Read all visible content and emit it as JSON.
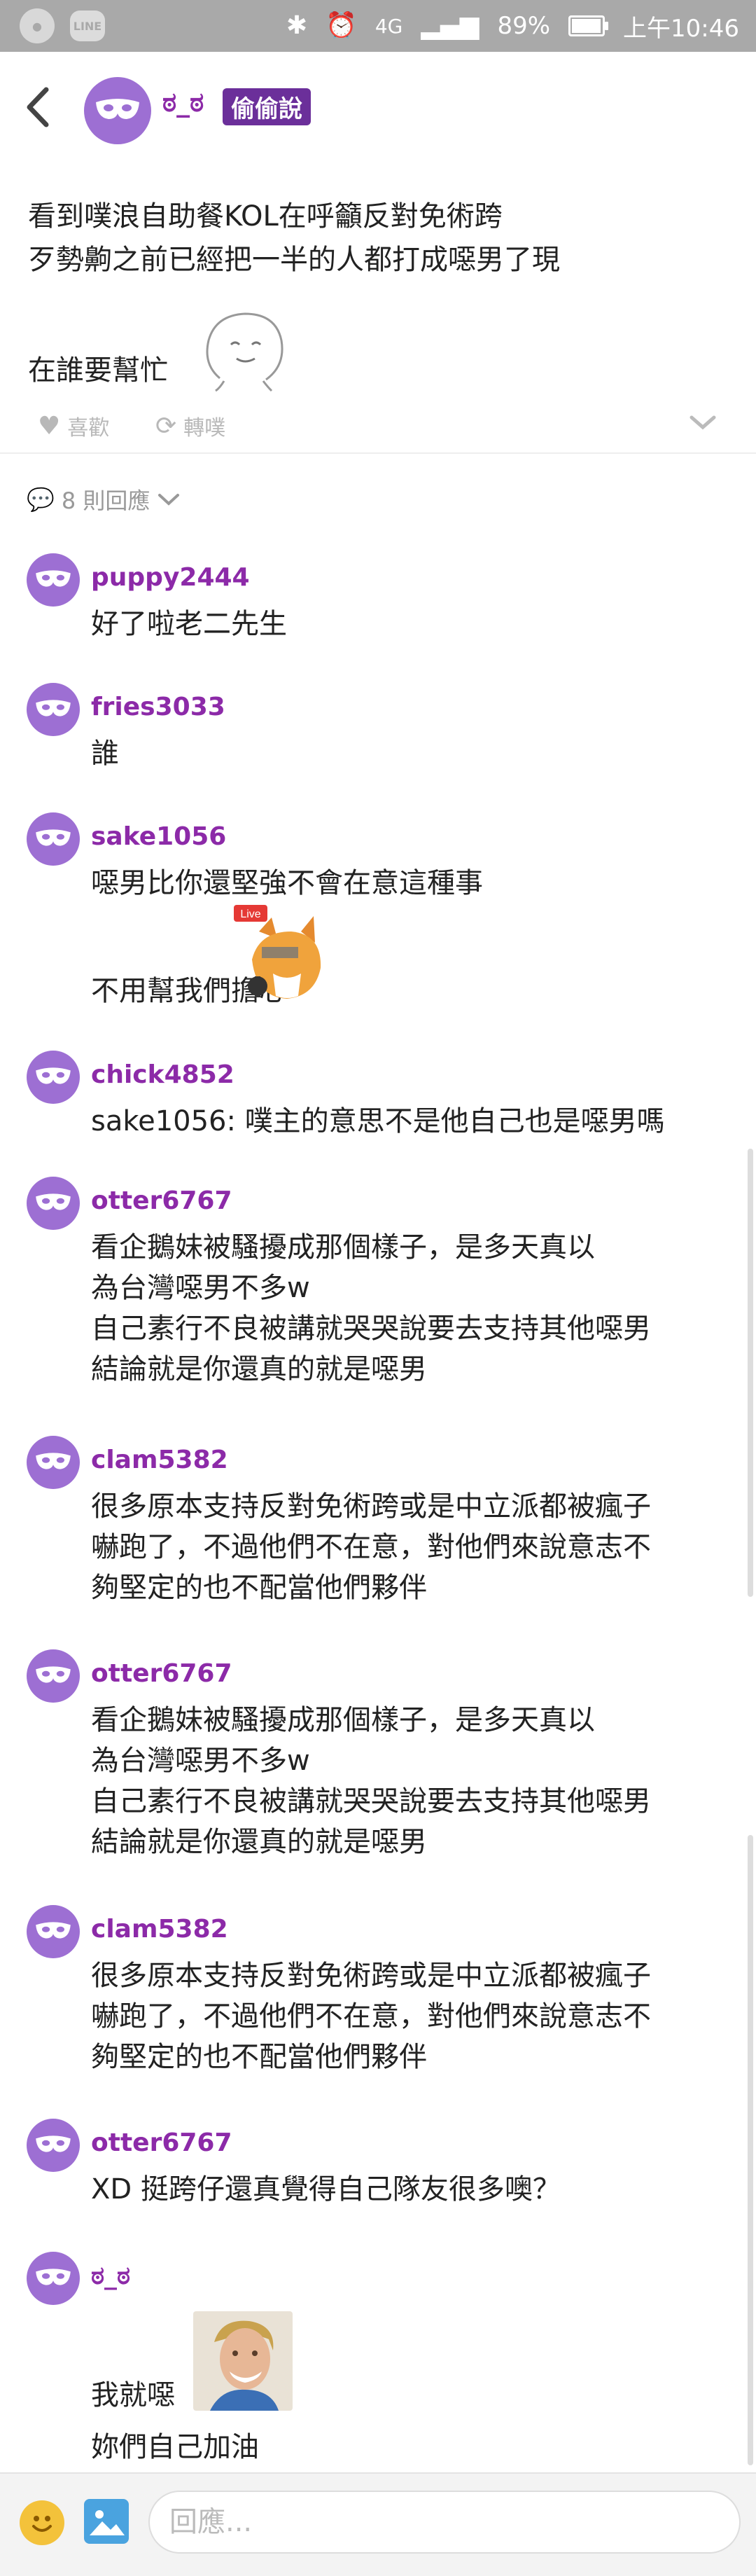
{
  "status_bar": {
    "icons_left": [
      "chat-bubble-icon",
      "line-app-icon"
    ],
    "line_label": "LINE",
    "network": "4G",
    "battery": "89%",
    "battery_level": 0.89,
    "time": "上午10:46"
  },
  "top_bar": {
    "op_name": "ಠ_ಠ",
    "badge": "偷偷說"
  },
  "post": {
    "lines": [
      "看到噗浪自助餐KOL在呼籲反對免術跨",
      "歹勢齁之前已經把一半的人都打成噁男了現"
    ],
    "tail": "在誰要幫忙"
  },
  "actions": {
    "like": "喜歡",
    "share": "轉噗"
  },
  "replies_header": "8 則回應",
  "replies": [
    {
      "name": "puppy2444",
      "lines": [
        "好了啦老二先生"
      ]
    },
    {
      "name": "fries3033",
      "lines": [
        "誰"
      ]
    },
    {
      "name": "sake1056",
      "lines": [
        "噁男比你還堅強不會在意這種事"
      ],
      "extra": "不用幫我們擔心"
    },
    {
      "name": "chick4852",
      "lines": [
        "sake1056: 噗主的意思不是他自己也是噁男嗎"
      ]
    },
    {
      "name": "otter6767",
      "lines": [
        "看企鵝妹被騷擾成那個樣子，是多天真以",
        "為台灣噁男不多w",
        "自己素行不良被講就哭哭說要去支持其他噁男",
        "結論就是你還真的就是噁男"
      ]
    },
    {
      "name": "clam5382",
      "lines": [
        "很多原本支持反對免術跨或是中立派都被瘋子",
        "嚇跑了，不過他們不在意，對他們來說意志不",
        "夠堅定的也不配當他們夥伴"
      ]
    },
    {
      "name": "otter6767",
      "lines": [
        "看企鵝妹被騷擾成那個樣子，是多天真以",
        "為台灣噁男不多w",
        "自己素行不良被講就哭哭說要去支持其他噁男",
        "結論就是你還真的就是噁男"
      ]
    },
    {
      "name": "clam5382",
      "lines": [
        "很多原本支持反對免術跨或是中立派都被瘋子",
        "嚇跑了，不過他們不在意，對他們來說意志不",
        "夠堅定的也不配當他們夥伴"
      ]
    },
    {
      "name": "otter6767",
      "lines": [
        "XD 挺跨仔還真覺得自己隊友很多噢？"
      ]
    },
    {
      "name": "ಠ_ಠ",
      "lines": [
        "我就噁",
        "妳們自己加油"
      ]
    }
  ],
  "fox_label": "Live",
  "composer": {
    "placeholder": "回應..."
  }
}
